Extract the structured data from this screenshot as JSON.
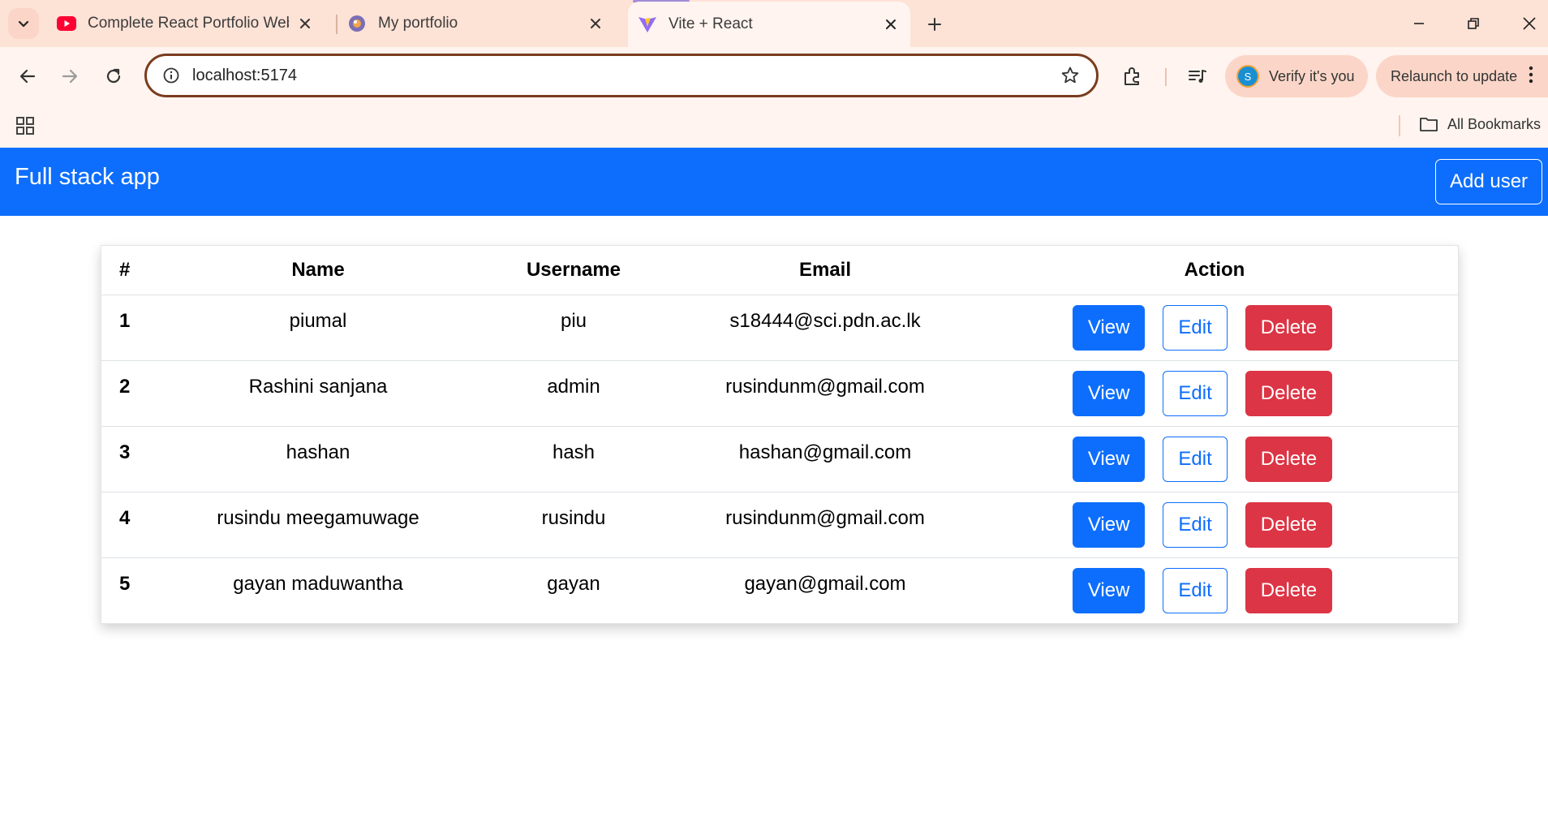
{
  "browser": {
    "tabs": [
      {
        "title": "Complete React Portfolio Websi",
        "favicon": "youtube-icon",
        "active": false
      },
      {
        "title": "My portfolio",
        "favicon": "globe-icon",
        "active": false
      },
      {
        "title": "Vite + React",
        "favicon": "vite-icon",
        "active": true
      }
    ],
    "url": "localhost:5174",
    "verify_label": "Verify it's you",
    "avatar_letter": "S",
    "relaunch_label": "Relaunch to update",
    "all_bookmarks_label": "All Bookmarks",
    "colors": {
      "tab_strip": "#fde2d6",
      "toolbar": "#fff4ef",
      "omnibox_border": "#7a3c1f"
    }
  },
  "app": {
    "brand": "Full stack app",
    "add_user_label": "Add user",
    "colors": {
      "navbar": "#0d6efd",
      "primary": "#0d6efd",
      "danger": "#dc3545"
    }
  },
  "table": {
    "headers": [
      "#",
      "Name",
      "Username",
      "Email",
      "Action"
    ],
    "rows": [
      {
        "id": "1",
        "name": "piumal",
        "username": "piu",
        "email": "s18444@sci.pdn.ac.lk"
      },
      {
        "id": "2",
        "name": "Rashini sanjana",
        "username": "admin",
        "email": "rusindunm@gmail.com"
      },
      {
        "id": "3",
        "name": "hashan",
        "username": "hash",
        "email": "hashan@gmail.com"
      },
      {
        "id": "4",
        "name": "rusindu meegamuwage",
        "username": "rusindu",
        "email": "rusindunm@gmail.com"
      },
      {
        "id": "5",
        "name": "gayan maduwantha",
        "username": "gayan",
        "email": "gayan@gmail.com"
      }
    ],
    "actions": {
      "view": "View",
      "edit": "Edit",
      "delete": "Delete"
    }
  }
}
